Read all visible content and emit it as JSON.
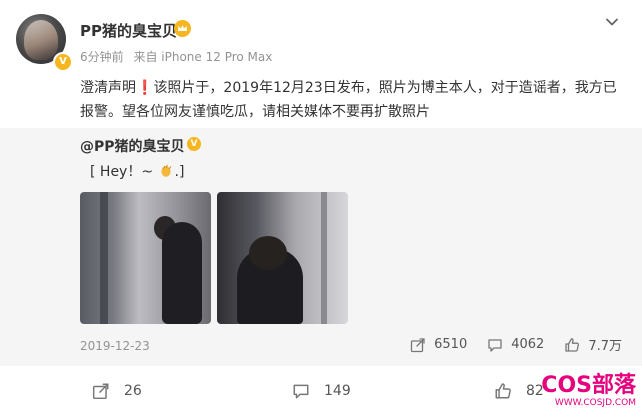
{
  "post": {
    "username": "PP猪的臭宝贝",
    "time_ago": "6分钟前",
    "source": "来自 iPhone 12 Pro Max",
    "text_part1": "澄清声明",
    "text_marker": "❗",
    "text_part2": "该照片于，2019年12月23日发布，照片为博主本人，对于造谣者，我方已报警。望各位网友谨慎吃瓜，请相关媒体不要再扩散照片"
  },
  "repost": {
    "username": "@PP猪的臭宝贝",
    "text_before": "[ Hey！~",
    "text_after": ".]",
    "date": "2019-12-23",
    "stats": {
      "shares": "6510",
      "comments": "4062",
      "likes": "7.7万"
    }
  },
  "actions": {
    "share_count": "26",
    "comment_count": "149",
    "like_count": "82"
  },
  "watermark": {
    "logo": "COS部落",
    "site": "WWW.COSJD.COM"
  },
  "icons": {
    "verified": "verified-badge-icon",
    "crown": "crown-icon",
    "more": "chevron-down-icon",
    "share": "share-icon",
    "comment": "comment-icon",
    "like": "thumbs-up-icon",
    "clap": "clapping-hands-icon"
  },
  "colors": {
    "accent_gold": "#f6b620",
    "marker_red": "#e5484d",
    "watermark_pink": "#e6007e"
  }
}
